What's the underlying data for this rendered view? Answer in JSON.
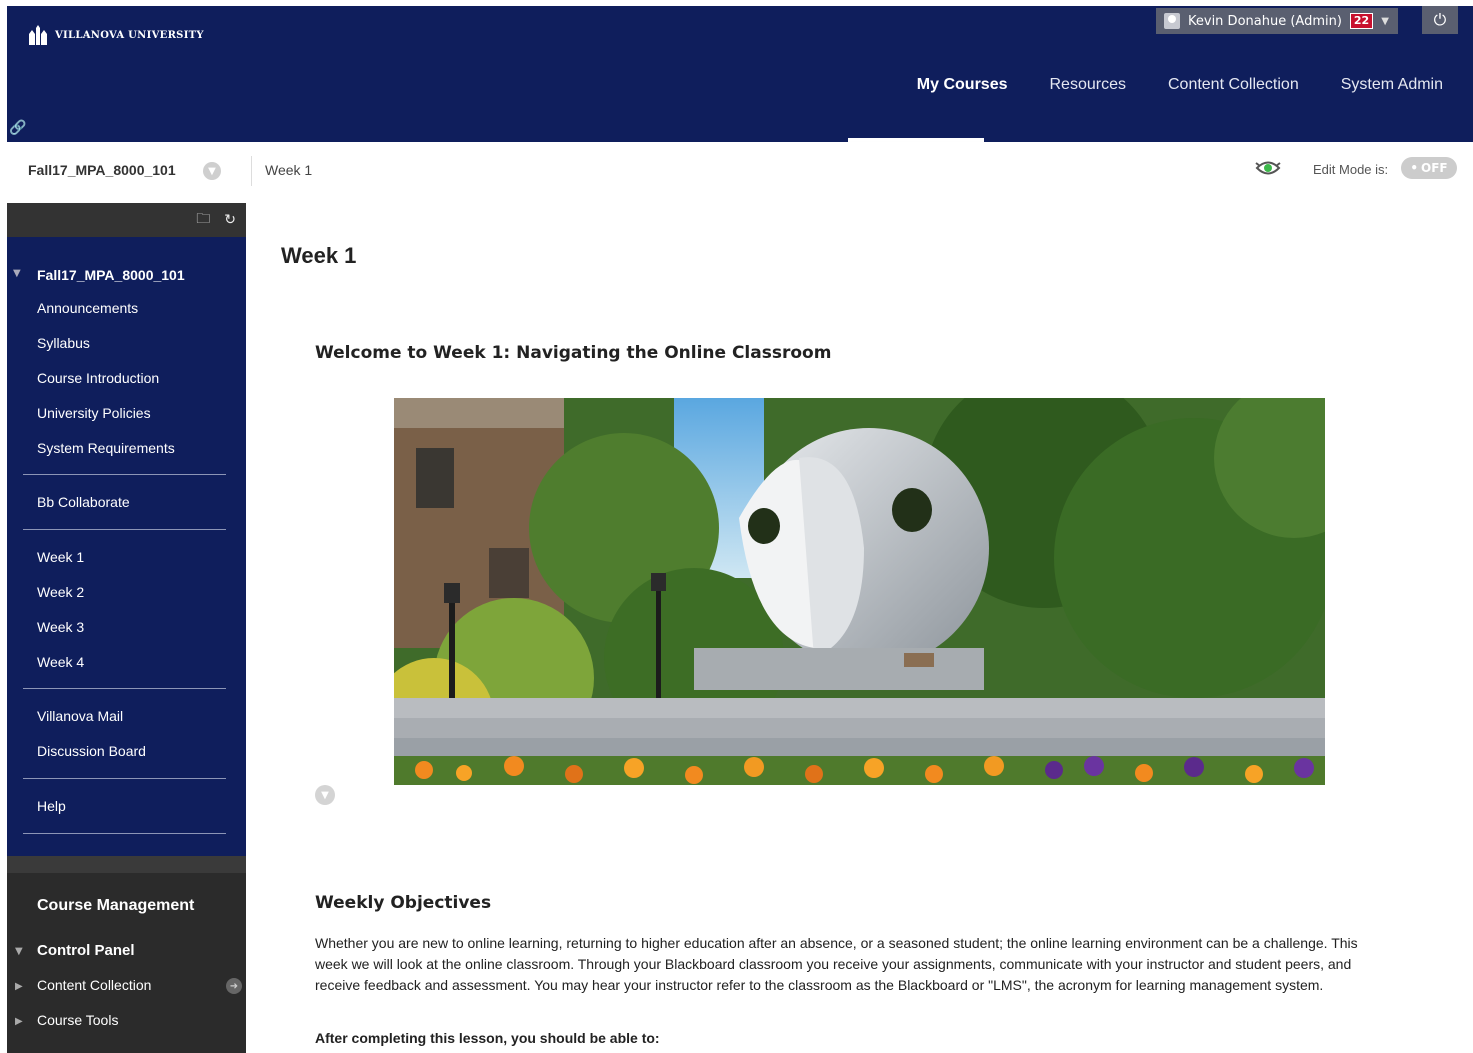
{
  "header": {
    "logo_text": "VILLANOVA UNIVERSITY",
    "user_name": "Kevin Donahue (Admin)",
    "notification_count": "22",
    "nav": [
      "My Courses",
      "Resources",
      "Content Collection",
      "System Admin"
    ],
    "active_nav": "My Courses",
    "brand_color": "#0f1e5c"
  },
  "breadcrumb": {
    "course": "Fall17_MPA_8000_101",
    "page": "Week 1",
    "edit_mode_label": "Edit Mode is:",
    "edit_mode_state": "OFF"
  },
  "sidebar": {
    "course_title": "Fall17_MPA_8000_101",
    "groups": [
      [
        "Announcements",
        "Syllabus",
        "Course Introduction",
        "University Policies",
        "System Requirements"
      ],
      [
        "Bb Collaborate"
      ],
      [
        "Week 1",
        "Week 2",
        "Week 3",
        "Week 4"
      ],
      [
        "Villanova Mail",
        "Discussion Board"
      ],
      [
        "Help"
      ]
    ],
    "management": {
      "title": "Course Management",
      "control_panel": "Control Panel",
      "items": [
        "Content Collection",
        "Course Tools"
      ]
    }
  },
  "content": {
    "title": "Week 1",
    "welcome_heading": "Welcome to Week 1: Navigating the Online Classroom",
    "objectives_heading": "Weekly Objectives",
    "objectives_text": "Whether you are new to online learning, returning to higher education after an absence, or a seasoned student; the online learning environment can be a challenge. This week we will look at the online classroom. Through your Blackboard classroom you receive your assignments, communicate with your instructor and student peers, and receive feedback and assessment. You may hear your instructor refer to the classroom as the Blackboard or \"LMS\", the acronym for learning management system.",
    "after_heading": "After completing this lesson, you should be able to:"
  }
}
